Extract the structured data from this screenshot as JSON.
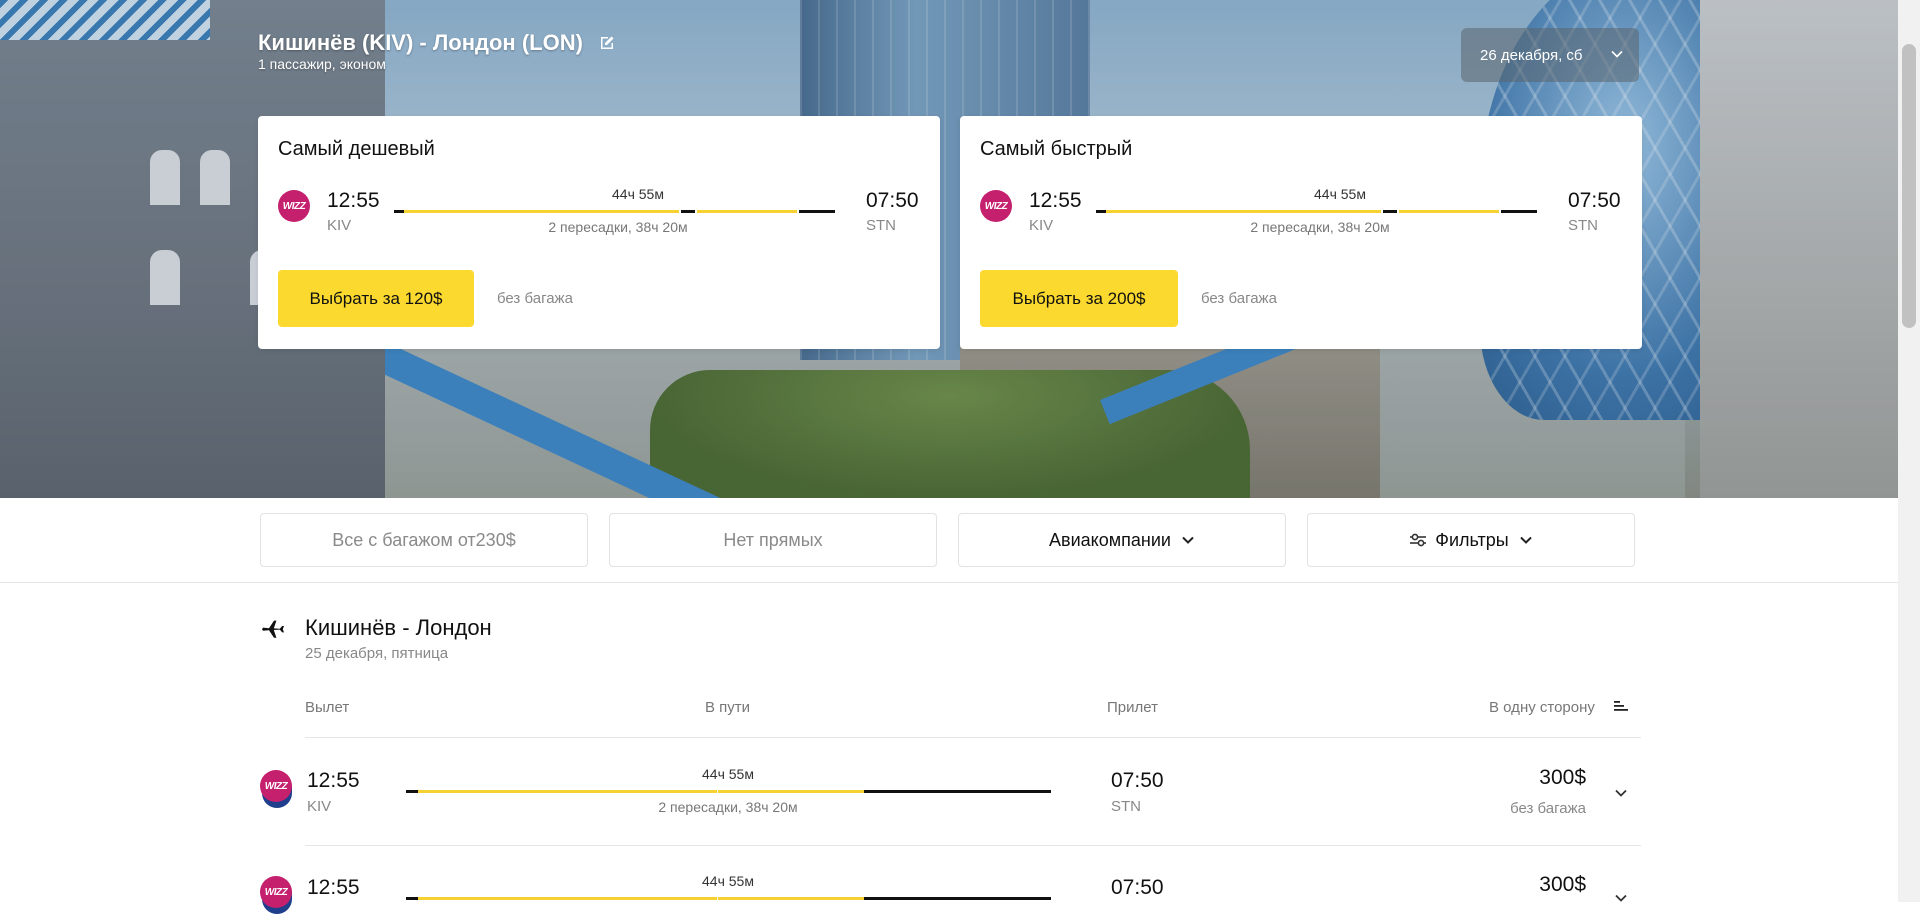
{
  "header": {
    "route": "Кишинёв (KIV) - Лондон (LON)",
    "passengers": "1 пассажир, эконом",
    "date": "26 декабря, сб"
  },
  "cards": [
    {
      "title": "Самый дешевый",
      "dep_time": "12:55",
      "dep_code": "KIV",
      "duration": "44ч 55м",
      "stops": "2 пересадки, 38ч 20м",
      "arr_time": "07:50",
      "arr_code": "STN",
      "cta": "Выбрать за 120$",
      "baggage": "без багажа"
    },
    {
      "title": "Самый быстрый",
      "dep_time": "12:55",
      "dep_code": "KIV",
      "duration": "44ч 55м",
      "stops": "2 пересадки, 38ч 20м",
      "arr_time": "07:50",
      "arr_code": "STN",
      "cta": "Выбрать за 200$",
      "baggage": "без багажа"
    }
  ],
  "filters": {
    "with_baggage": "Все с багажом от230$",
    "no_direct": "Нет прямых",
    "airlines": "Авиакомпании",
    "filters": "Фильтры"
  },
  "list": {
    "title": "Кишинёв - Лондон",
    "date": "25 декабря, пятница",
    "columns": {
      "departure": "Вылет",
      "in_transit": "В пути",
      "arrival": "Прилет",
      "one_way": "В одну сторону"
    },
    "rows": [
      {
        "dep_time": "12:55",
        "dep_code": "KIV",
        "duration": "44ч 55м",
        "stops": "2 пересадки, 38ч 20м",
        "arr_time": "07:50",
        "arr_code": "STN",
        "price": "300$",
        "baggage": "без багажа"
      },
      {
        "dep_time": "12:55",
        "duration": "44ч 55м",
        "arr_time": "07:50",
        "price": "300$"
      }
    ]
  },
  "airline_logo_text": "WIZZ",
  "colors": {
    "accent": "#fbd92e",
    "segment_yellow": "#f5d232",
    "segment_dark": "#111111",
    "wizz_pink": "#c4206e",
    "wizz_navy": "#1f3f8c"
  }
}
